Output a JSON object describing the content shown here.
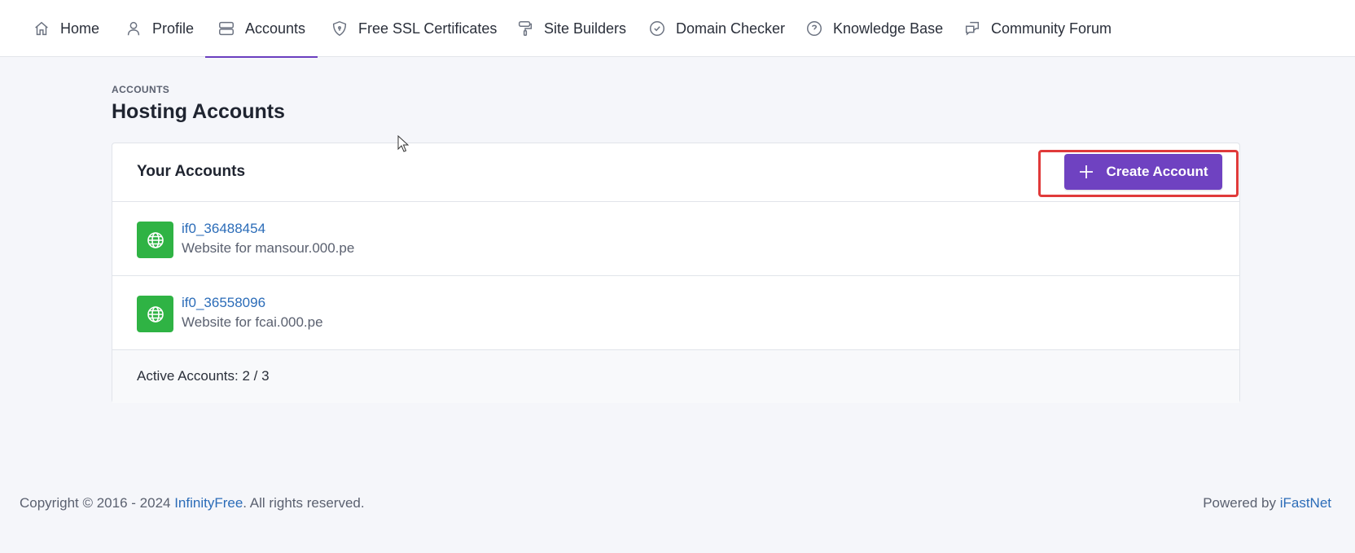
{
  "nav": {
    "items": [
      {
        "label": "Home",
        "icon": "home-icon"
      },
      {
        "label": "Profile",
        "icon": "user-icon"
      },
      {
        "label": "Accounts",
        "icon": "server-icon",
        "active": true
      },
      {
        "label": "Free SSL Certificates",
        "icon": "shield-icon"
      },
      {
        "label": "Site Builders",
        "icon": "paint-roller-icon"
      },
      {
        "label": "Domain Checker",
        "icon": "check-circle-icon"
      },
      {
        "label": "Knowledge Base",
        "icon": "help-circle-icon"
      },
      {
        "label": "Community Forum",
        "icon": "messages-icon"
      }
    ]
  },
  "page": {
    "eyebrow": "ACCOUNTS",
    "title": "Hosting Accounts"
  },
  "card": {
    "title": "Your Accounts",
    "create_button": "Create Account",
    "accounts": [
      {
        "id": "if0_36488454",
        "description": "Website for mansour.000.pe"
      },
      {
        "id": "if0_36558096",
        "description": "Website for fcai.000.pe"
      }
    ],
    "footer": "Active Accounts: 2 / 3"
  },
  "footer": {
    "copyright_prefix": "Copyright © 2016 - 2024 ",
    "copyright_link": "InfinityFree",
    "copyright_suffix": ". All rights reserved.",
    "powered_prefix": "Powered by ",
    "powered_link": "iFastNet"
  },
  "colors": {
    "accent": "#6f42c1",
    "link": "#2b6cb8",
    "account_icon_bg": "#2fb344",
    "highlight": "#e03a3a"
  }
}
